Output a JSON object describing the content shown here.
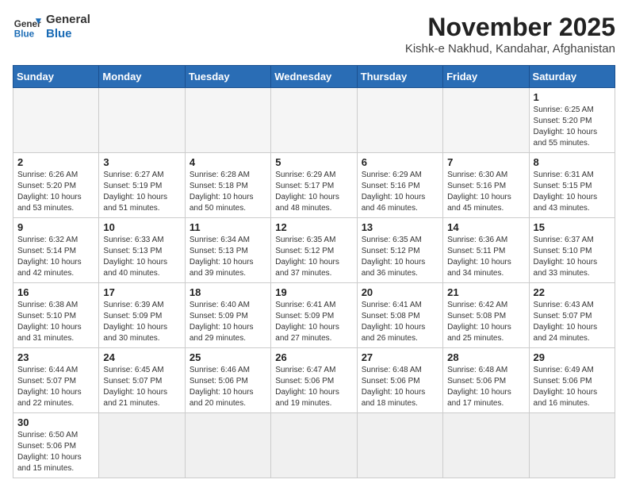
{
  "header": {
    "logo_general": "General",
    "logo_blue": "Blue",
    "month_title": "November 2025",
    "subtitle": "Kishk-e Nakhud, Kandahar, Afghanistan"
  },
  "calendar": {
    "days_of_week": [
      "Sunday",
      "Monday",
      "Tuesday",
      "Wednesday",
      "Thursday",
      "Friday",
      "Saturday"
    ],
    "weeks": [
      [
        {
          "day": "",
          "info": ""
        },
        {
          "day": "",
          "info": ""
        },
        {
          "day": "",
          "info": ""
        },
        {
          "day": "",
          "info": ""
        },
        {
          "day": "",
          "info": ""
        },
        {
          "day": "",
          "info": ""
        },
        {
          "day": "1",
          "info": "Sunrise: 6:25 AM\nSunset: 5:20 PM\nDaylight: 10 hours\nand 55 minutes."
        }
      ],
      [
        {
          "day": "2",
          "info": "Sunrise: 6:26 AM\nSunset: 5:20 PM\nDaylight: 10 hours\nand 53 minutes."
        },
        {
          "day": "3",
          "info": "Sunrise: 6:27 AM\nSunset: 5:19 PM\nDaylight: 10 hours\nand 51 minutes."
        },
        {
          "day": "4",
          "info": "Sunrise: 6:28 AM\nSunset: 5:18 PM\nDaylight: 10 hours\nand 50 minutes."
        },
        {
          "day": "5",
          "info": "Sunrise: 6:29 AM\nSunset: 5:17 PM\nDaylight: 10 hours\nand 48 minutes."
        },
        {
          "day": "6",
          "info": "Sunrise: 6:29 AM\nSunset: 5:16 PM\nDaylight: 10 hours\nand 46 minutes."
        },
        {
          "day": "7",
          "info": "Sunrise: 6:30 AM\nSunset: 5:16 PM\nDaylight: 10 hours\nand 45 minutes."
        },
        {
          "day": "8",
          "info": "Sunrise: 6:31 AM\nSunset: 5:15 PM\nDaylight: 10 hours\nand 43 minutes."
        }
      ],
      [
        {
          "day": "9",
          "info": "Sunrise: 6:32 AM\nSunset: 5:14 PM\nDaylight: 10 hours\nand 42 minutes."
        },
        {
          "day": "10",
          "info": "Sunrise: 6:33 AM\nSunset: 5:13 PM\nDaylight: 10 hours\nand 40 minutes."
        },
        {
          "day": "11",
          "info": "Sunrise: 6:34 AM\nSunset: 5:13 PM\nDaylight: 10 hours\nand 39 minutes."
        },
        {
          "day": "12",
          "info": "Sunrise: 6:35 AM\nSunset: 5:12 PM\nDaylight: 10 hours\nand 37 minutes."
        },
        {
          "day": "13",
          "info": "Sunrise: 6:35 AM\nSunset: 5:12 PM\nDaylight: 10 hours\nand 36 minutes."
        },
        {
          "day": "14",
          "info": "Sunrise: 6:36 AM\nSunset: 5:11 PM\nDaylight: 10 hours\nand 34 minutes."
        },
        {
          "day": "15",
          "info": "Sunrise: 6:37 AM\nSunset: 5:10 PM\nDaylight: 10 hours\nand 33 minutes."
        }
      ],
      [
        {
          "day": "16",
          "info": "Sunrise: 6:38 AM\nSunset: 5:10 PM\nDaylight: 10 hours\nand 31 minutes."
        },
        {
          "day": "17",
          "info": "Sunrise: 6:39 AM\nSunset: 5:09 PM\nDaylight: 10 hours\nand 30 minutes."
        },
        {
          "day": "18",
          "info": "Sunrise: 6:40 AM\nSunset: 5:09 PM\nDaylight: 10 hours\nand 29 minutes."
        },
        {
          "day": "19",
          "info": "Sunrise: 6:41 AM\nSunset: 5:09 PM\nDaylight: 10 hours\nand 27 minutes."
        },
        {
          "day": "20",
          "info": "Sunrise: 6:41 AM\nSunset: 5:08 PM\nDaylight: 10 hours\nand 26 minutes."
        },
        {
          "day": "21",
          "info": "Sunrise: 6:42 AM\nSunset: 5:08 PM\nDaylight: 10 hours\nand 25 minutes."
        },
        {
          "day": "22",
          "info": "Sunrise: 6:43 AM\nSunset: 5:07 PM\nDaylight: 10 hours\nand 24 minutes."
        }
      ],
      [
        {
          "day": "23",
          "info": "Sunrise: 6:44 AM\nSunset: 5:07 PM\nDaylight: 10 hours\nand 22 minutes."
        },
        {
          "day": "24",
          "info": "Sunrise: 6:45 AM\nSunset: 5:07 PM\nDaylight: 10 hours\nand 21 minutes."
        },
        {
          "day": "25",
          "info": "Sunrise: 6:46 AM\nSunset: 5:06 PM\nDaylight: 10 hours\nand 20 minutes."
        },
        {
          "day": "26",
          "info": "Sunrise: 6:47 AM\nSunset: 5:06 PM\nDaylight: 10 hours\nand 19 minutes."
        },
        {
          "day": "27",
          "info": "Sunrise: 6:48 AM\nSunset: 5:06 PM\nDaylight: 10 hours\nand 18 minutes."
        },
        {
          "day": "28",
          "info": "Sunrise: 6:48 AM\nSunset: 5:06 PM\nDaylight: 10 hours\nand 17 minutes."
        },
        {
          "day": "29",
          "info": "Sunrise: 6:49 AM\nSunset: 5:06 PM\nDaylight: 10 hours\nand 16 minutes."
        }
      ],
      [
        {
          "day": "30",
          "info": "Sunrise: 6:50 AM\nSunset: 5:06 PM\nDaylight: 10 hours\nand 15 minutes."
        },
        {
          "day": "",
          "info": ""
        },
        {
          "day": "",
          "info": ""
        },
        {
          "day": "",
          "info": ""
        },
        {
          "day": "",
          "info": ""
        },
        {
          "day": "",
          "info": ""
        },
        {
          "day": "",
          "info": ""
        }
      ]
    ]
  }
}
